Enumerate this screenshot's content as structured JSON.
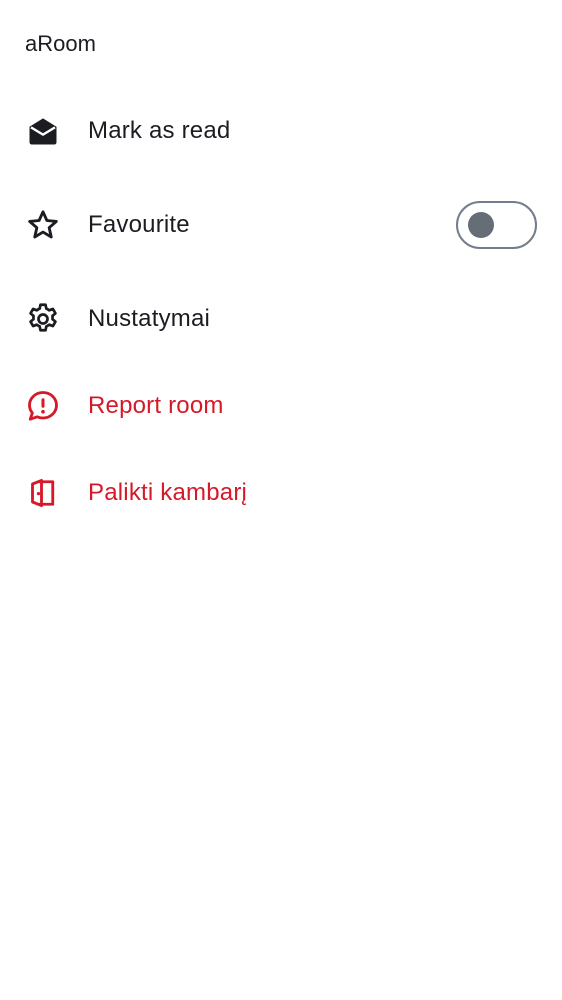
{
  "room": {
    "name": "aRoom"
  },
  "menu": {
    "items": [
      {
        "label": "Mark as read",
        "icon": "envelope-open-icon",
        "critical": false
      },
      {
        "label": "Favourite",
        "icon": "star-outline-icon",
        "critical": false,
        "toggle": {
          "on": false
        }
      },
      {
        "label": "Nustatymai",
        "icon": "gear-icon",
        "critical": false
      },
      {
        "label": "Report room",
        "icon": "report-bubble-icon",
        "critical": true
      },
      {
        "label": "Palikti kambarį",
        "icon": "leave-door-icon",
        "critical": true
      }
    ]
  },
  "colors": {
    "text_primary": "#1b1d22",
    "critical": "#d51928",
    "toggle_border": "#737d8c",
    "toggle_knob": "#656d77",
    "background": "#ffffff"
  }
}
